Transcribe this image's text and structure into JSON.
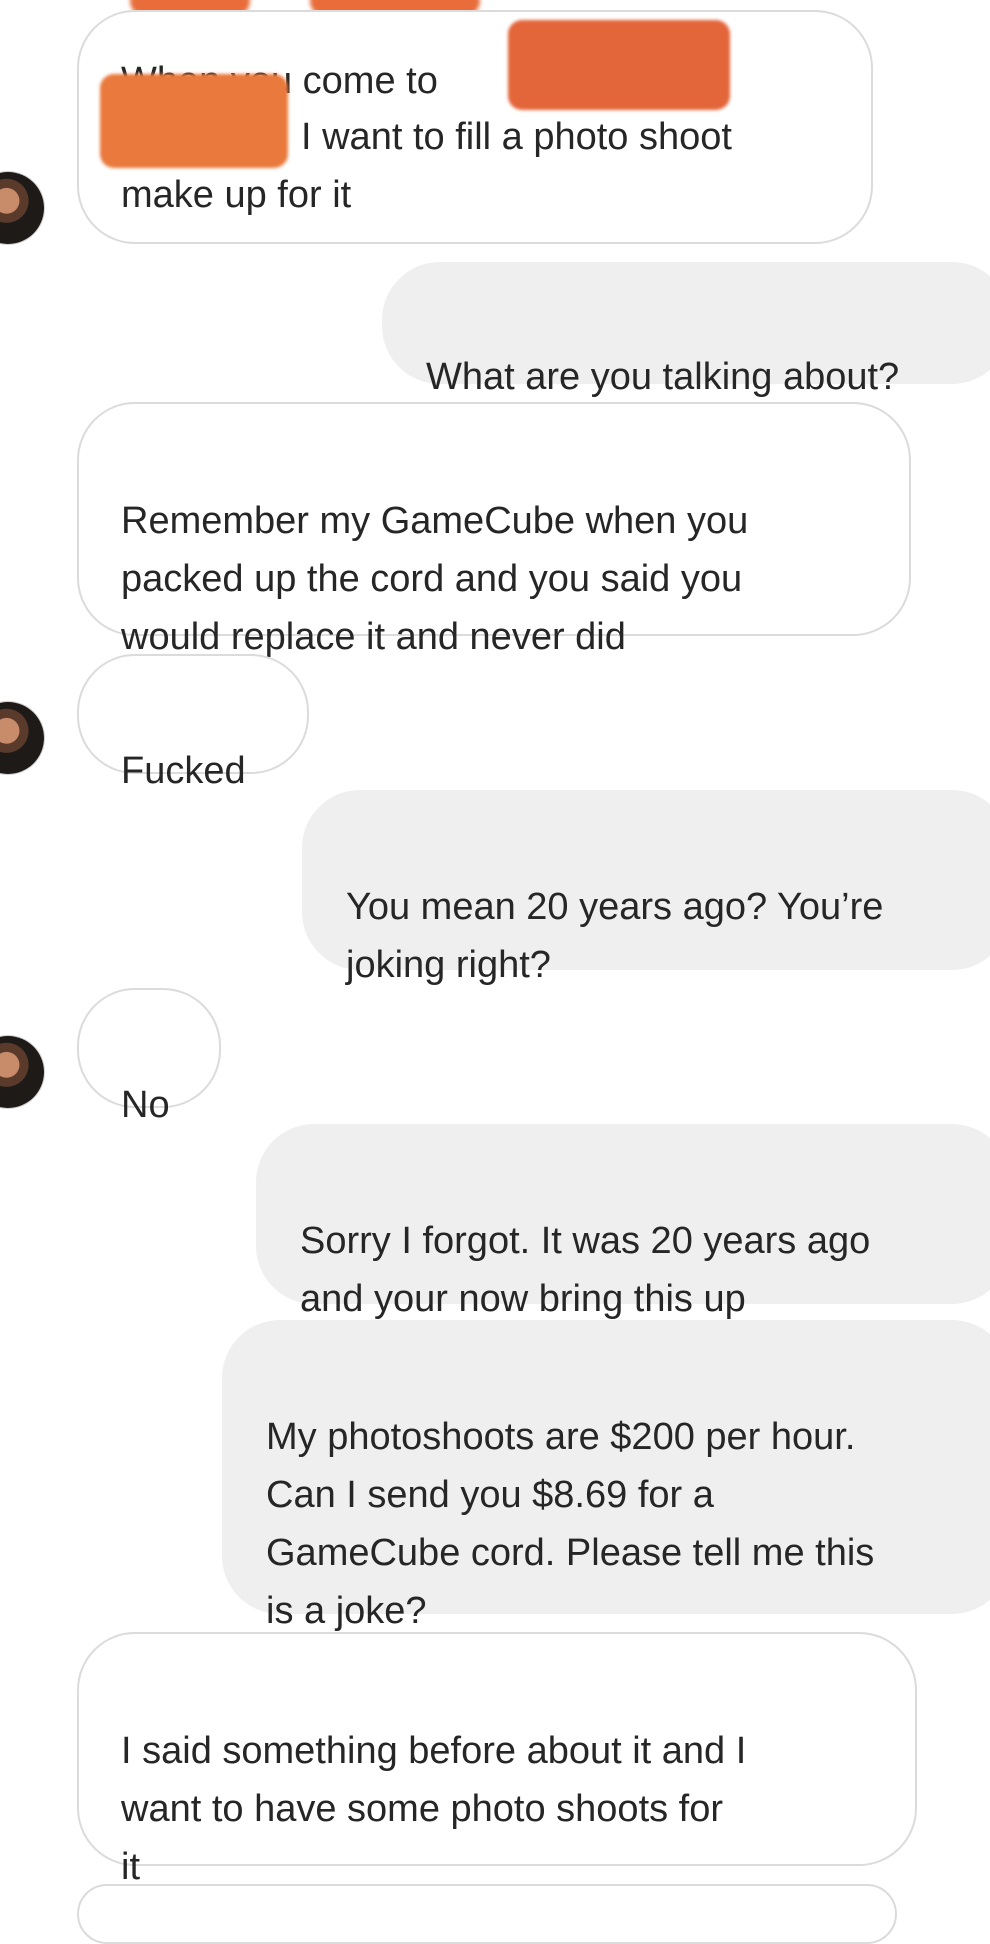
{
  "messages": [
    {
      "id": "m1",
      "side": "incoming",
      "lines": [
        "When you come to",
        "I want to fill a photo shoot",
        "make up for it"
      ]
    },
    {
      "id": "m2",
      "side": "outgoing",
      "text": "What are you talking about?"
    },
    {
      "id": "m3",
      "side": "incoming",
      "text": "Remember my GameCube when you\npacked up the cord and you said you\nwould replace it and never did"
    },
    {
      "id": "m4",
      "side": "incoming",
      "text": "Fucked"
    },
    {
      "id": "m5",
      "side": "outgoing",
      "text": "You mean 20 years ago? You’re\njoking right?"
    },
    {
      "id": "m6",
      "side": "incoming",
      "text": "No"
    },
    {
      "id": "m7",
      "side": "outgoing",
      "text": "Sorry I forgot. It was 20 years ago\nand your now bring this up"
    },
    {
      "id": "m8",
      "side": "outgoing",
      "text": "My photoshoots are $200 per hour.\nCan I send you $8.69 for a\nGameCube cord. Please tell me this\nis a joke?"
    },
    {
      "id": "m9",
      "side": "incoming",
      "text": "I said something before about it and I\nwant to have some photo shoots for\nit"
    }
  ],
  "colors": {
    "incoming_bg": "#ffffff",
    "incoming_border": "#dbdbdb",
    "outgoing_bg": "#efefef",
    "text": "#262626",
    "redaction": "#e3663a"
  }
}
